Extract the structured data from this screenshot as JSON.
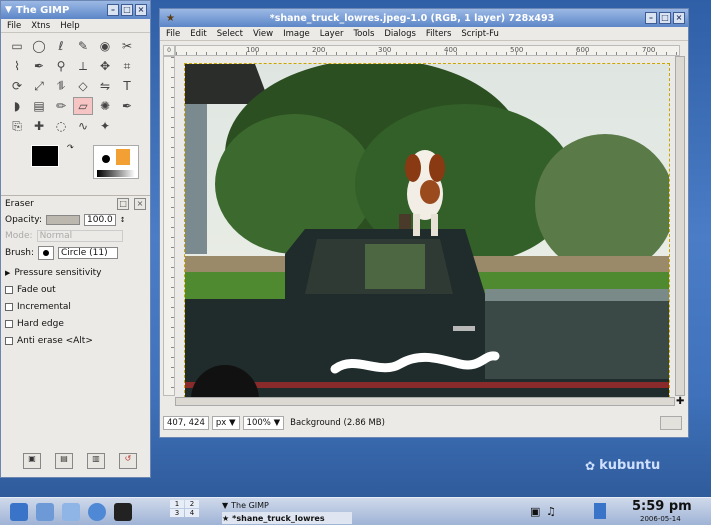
{
  "toolbox": {
    "title": "The GIMP",
    "menu": [
      "File",
      "Xtns",
      "Help"
    ],
    "tool_icons": [
      "rect-select-icon",
      "ellipse-select-icon",
      "lasso-icon",
      "fuzzy-select-icon",
      "color-select-icon",
      "scissors-icon",
      "paths-icon",
      "color-picker-icon",
      "zoom-icon",
      "measure-icon",
      "move-icon",
      "crop-icon",
      "rotate-icon",
      "scale-icon",
      "shear-icon",
      "perspective-icon",
      "flip-icon",
      "text-icon",
      "bucket-fill-icon",
      "blend-icon",
      "pencil-icon",
      "eraser-icon",
      "airbrush-icon",
      "ink-icon",
      "clone-icon",
      "heal-icon",
      "blur-icon",
      "smudge-icon",
      "dodge-icon"
    ],
    "active_tool_index": 21
  },
  "tool_options": {
    "title": "Eraser",
    "opacity_label": "Opacity:",
    "opacity_value": "100.0",
    "opacity_fraction": 1.0,
    "mode_label": "Mode:",
    "mode_value": "Normal",
    "brush_label": "Brush:",
    "brush_value": "Circle (11)",
    "pressure_label": "Pressure sensitivity",
    "checkboxes": [
      "Fade out",
      "Incremental",
      "Hard edge",
      "Anti erase  <Alt>"
    ]
  },
  "image_window": {
    "title": "*shane_truck_lowres.jpeg-1.0 (RGB, 1 layer) 728x493",
    "menu": [
      "File",
      "Edit",
      "Select",
      "View",
      "Image",
      "Layer",
      "Tools",
      "Dialogs",
      "Filters",
      "Script-Fu"
    ],
    "ruler_ticks": [
      "100",
      "200",
      "300",
      "400",
      "500",
      "600",
      "700"
    ],
    "ruler_corner": "0",
    "coords": "407, 424",
    "unit": "px",
    "zoom": "100%",
    "status": "Background (2.86 MB)"
  },
  "desktop": {
    "logo_text": "kubuntu"
  },
  "taskbar": {
    "desktop_numbers": [
      "1",
      "2",
      "3",
      "4"
    ],
    "tasks": [
      "The GIMP",
      "*shane_truck_lowres"
    ],
    "clock": "5:59 pm",
    "date": "2006-05-14"
  },
  "colors": {
    "title_gradient_start": "#9cb9e4",
    "title_gradient_end": "#5c86c8",
    "desktop_blue": "#3f72bb",
    "truck_green": "#1f2c2b"
  }
}
